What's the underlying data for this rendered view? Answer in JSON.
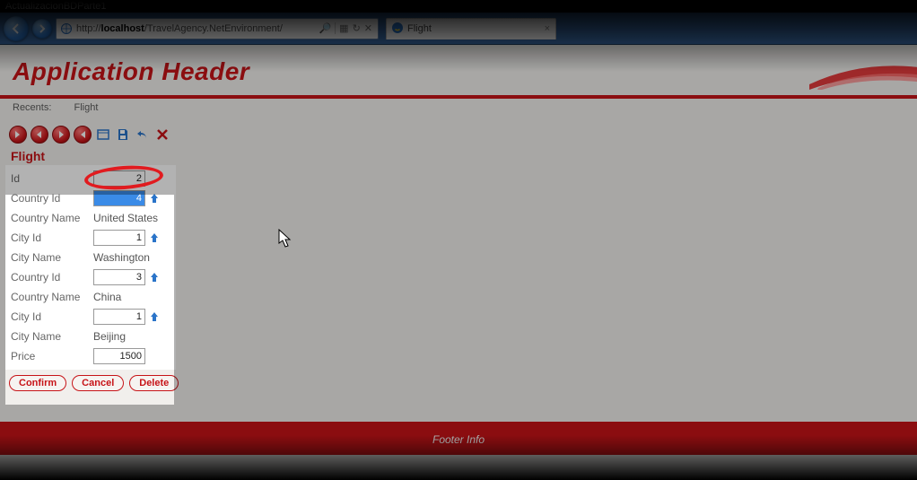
{
  "window": {
    "title": "ActualizacionBDParte1"
  },
  "browser": {
    "url_prefix": "http://",
    "url_host": "localhost",
    "url_path": "/TravelAgency.NetEnvironment/",
    "tab_title": "Flight"
  },
  "app": {
    "header_title": "Application Header",
    "recents_label": "Recents:",
    "recents_item": "Flight",
    "section_title": "Flight",
    "footer_text": "Footer Info"
  },
  "form": {
    "id_label": "Id",
    "id_value": "2",
    "country1_id_label": "Country Id",
    "country1_id_value": "4",
    "country1_name_label": "Country Name",
    "country1_name_value": "United States",
    "city1_id_label": "City Id",
    "city1_id_value": "1",
    "city1_name_label": "City Name",
    "city1_name_value": "Washington",
    "country2_id_label": "Country Id",
    "country2_id_value": "3",
    "country2_name_label": "Country Name",
    "country2_name_value": "China",
    "city2_id_label": "City Id",
    "city2_id_value": "1",
    "city2_name_label": "City Name",
    "city2_name_value": "Beijing",
    "price_label": "Price",
    "price_value": "1500"
  },
  "buttons": {
    "confirm": "Confirm",
    "cancel": "Cancel",
    "delete": "Delete"
  }
}
